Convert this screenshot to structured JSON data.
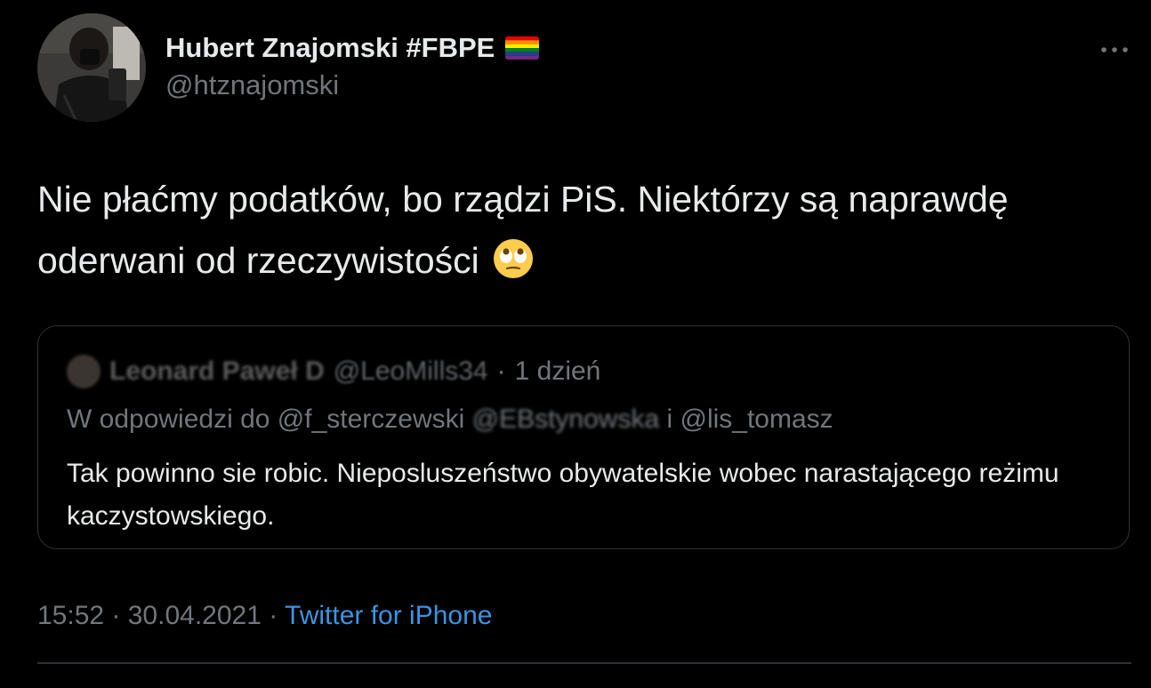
{
  "tweet": {
    "author_name": "Hubert Znajomski #FBPE",
    "author_handle": "@htznajomski",
    "text": "Nie płaćmy podatków, bo rządzi PiS. Niektórzy są naprawdę oderwani od rzeczywistości",
    "emoji": "face-with-rolling-eyes",
    "time": "15:52",
    "date": "30.04.2021",
    "separator": " · ",
    "source": "Twitter for iPhone"
  },
  "quote": {
    "author_name": "Leonard Paweł D",
    "author_handle": "@LeoMills34",
    "time_sep": " · ",
    "time": "1 dzień",
    "reply_prefix": "W odpowiedzi do @f_sterczewski ",
    "reply_blurred": "@EBstynowska",
    "reply_suffix": " i @lis_tomasz",
    "text": "Tak powinno sie robic. Nieposluszeństwo obywatelskie wobec narastającego reżimu kaczystowskiego."
  },
  "colors": {
    "background": "#000000",
    "text_primary": "#e7e9ea",
    "text_secondary": "#71767b",
    "link": "#3b94e0",
    "border": "#2f3336"
  },
  "icons": [
    "more-icon",
    "rainbow-flag-icon",
    "rolling-eyes-emoji-icon"
  ]
}
